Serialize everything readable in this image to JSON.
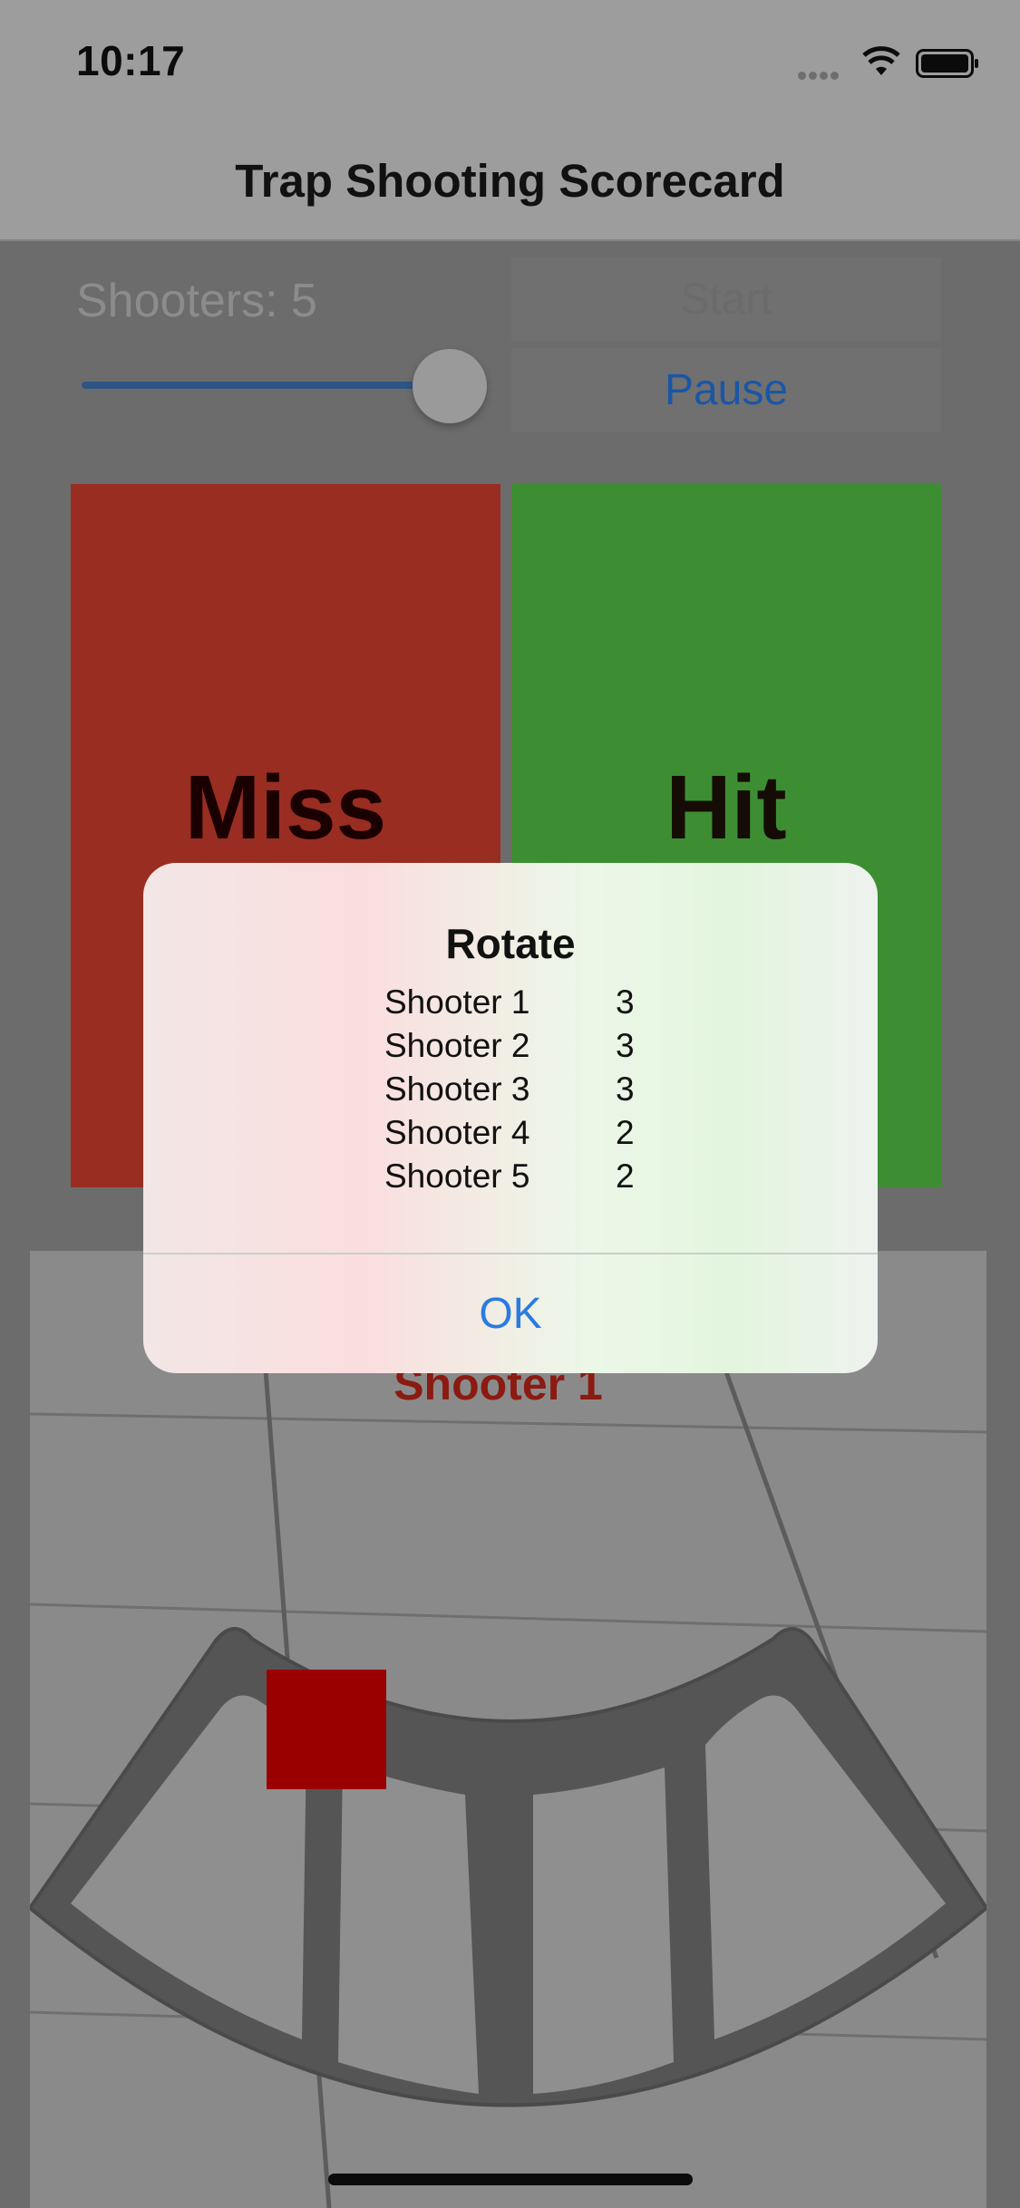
{
  "status_bar": {
    "time": "10:17"
  },
  "nav": {
    "title": "Trap Shooting Scorecard"
  },
  "controls": {
    "shooters_label": "Shooters: 5",
    "shooters_value": 5,
    "start_label": "Start",
    "pause_label": "Pause"
  },
  "buttons": {
    "miss": "Miss",
    "hit": "Hit"
  },
  "field": {
    "current_shooter": "Shooter 1"
  },
  "alert": {
    "title": "Rotate",
    "rows": [
      {
        "name": "Shooter 1",
        "score": "3"
      },
      {
        "name": "Shooter 2",
        "score": "3"
      },
      {
        "name": "Shooter 3",
        "score": "3"
      },
      {
        "name": "Shooter 4",
        "score": "2"
      },
      {
        "name": "Shooter 5",
        "score": "2"
      }
    ],
    "ok_label": "OK"
  },
  "colors": {
    "miss": "#992d21",
    "hit": "#3d8e33",
    "accent": "#2a7be0",
    "marker": "#9b0000"
  },
  "icons": [
    "signal-icon",
    "wifi-icon",
    "battery-icon"
  ]
}
